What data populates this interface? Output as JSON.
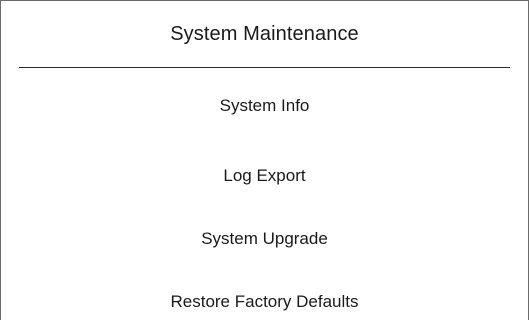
{
  "panel": {
    "title": "System Maintenance"
  },
  "menu": {
    "items": [
      {
        "label": "System Info"
      },
      {
        "label": "Log Export"
      },
      {
        "label": "System Upgrade"
      },
      {
        "label": "Restore Factory Defaults"
      }
    ]
  }
}
